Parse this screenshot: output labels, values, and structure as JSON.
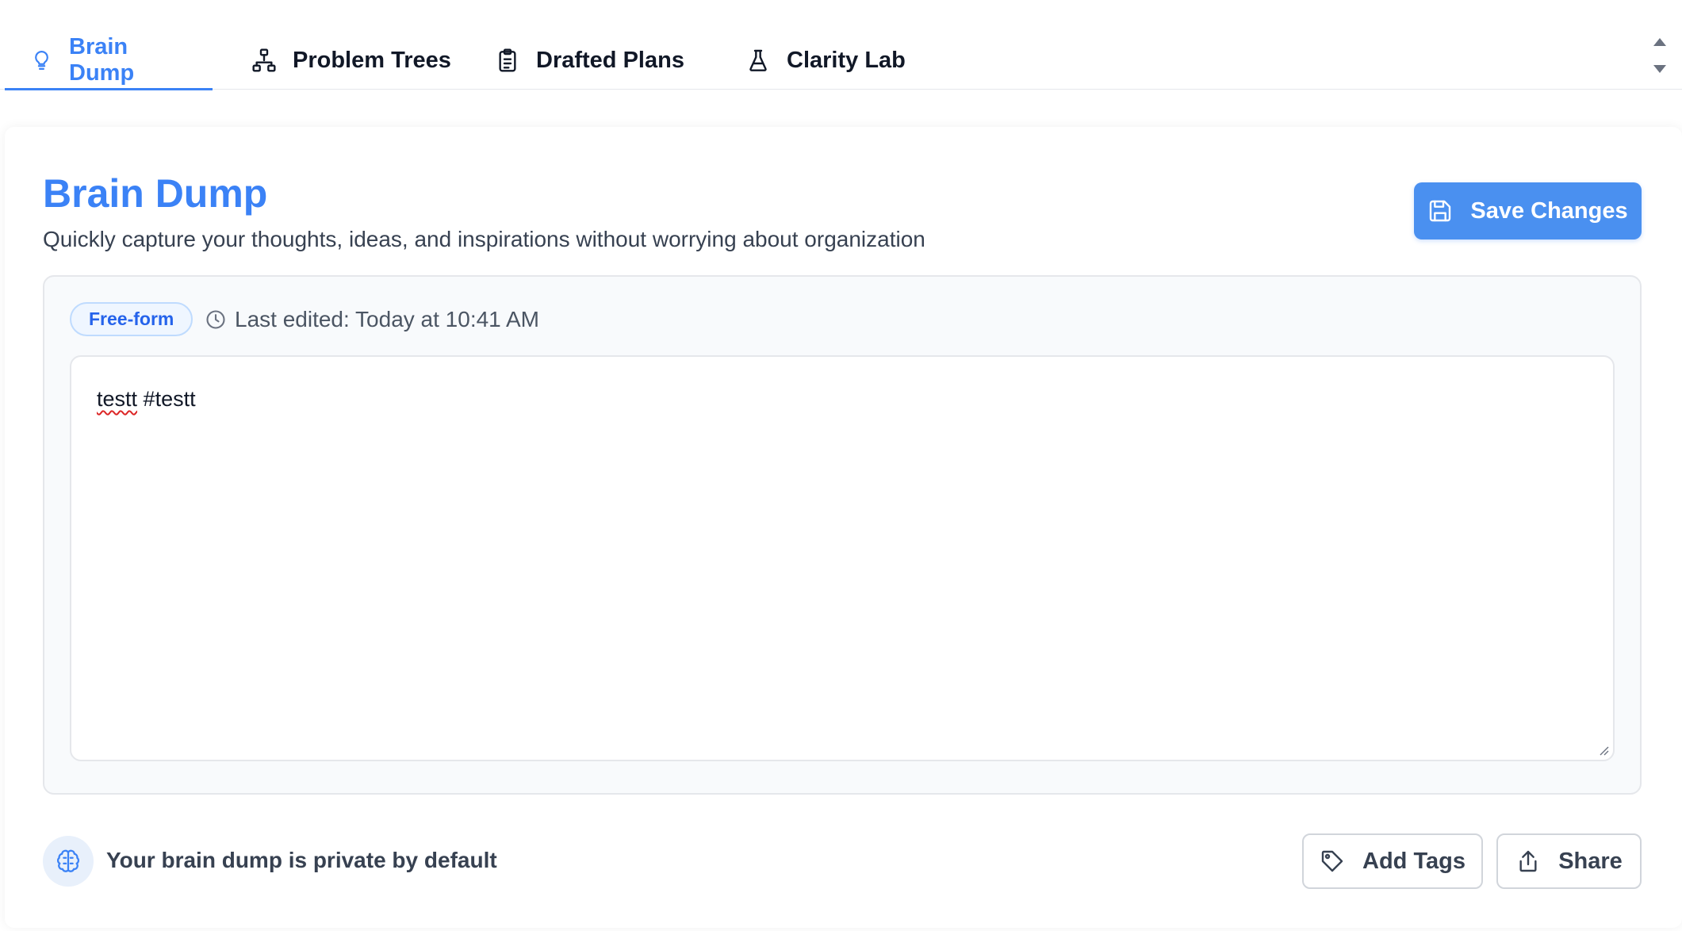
{
  "tabs": [
    {
      "label": "Brain Dump",
      "icon": "lightbulb-icon",
      "active": true
    },
    {
      "label": "Problem Trees",
      "icon": "network-icon",
      "active": false
    },
    {
      "label": "Drafted Plans",
      "icon": "clipboard-icon",
      "active": false
    },
    {
      "label": "Clarity Lab",
      "icon": "flask-icon",
      "active": false
    }
  ],
  "header": {
    "title": "Brain Dump",
    "subtitle": "Quickly capture your thoughts, ideas, and inspirations without worrying about organization",
    "save_label": "Save Changes"
  },
  "editor": {
    "badge": "Free-form",
    "last_edited": "Last edited: Today at 10:41 AM",
    "content_word": "testt",
    "content_tag": "#testt"
  },
  "footer": {
    "privacy_text": "Your brain dump is private by default",
    "tags_label": "Add Tags",
    "share_label": "Share"
  },
  "colors": {
    "accent": "#3b82f6",
    "button": "#4a90f0"
  }
}
